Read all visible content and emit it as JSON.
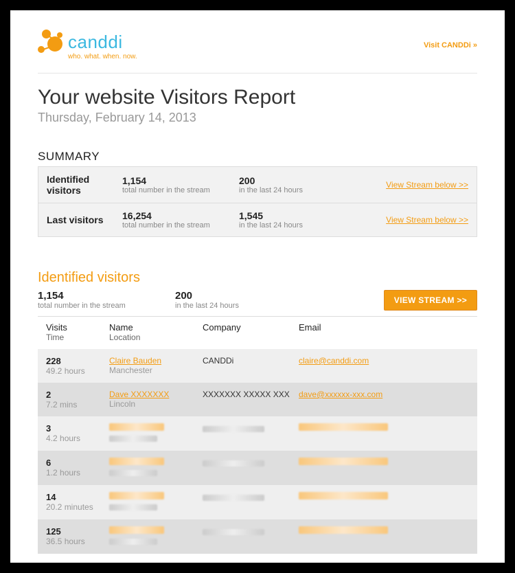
{
  "header": {
    "logo_text": "canddi",
    "logo_tagline": "who. what. when. now.",
    "visit_link": "Visit CANDDi »"
  },
  "title": {
    "heading": "Your website Visitors Report",
    "date": "Thursday, February 14, 2013"
  },
  "summary": {
    "heading": "SUMMARY",
    "rows": [
      {
        "label": "Identified visitors",
        "total_num": "1,154",
        "total_sub": "total number in the stream",
        "recent_num": "200",
        "recent_sub": "in the last 24 hours",
        "link": "View Stream below >>"
      },
      {
        "label": "Last visitors",
        "total_num": "16,254",
        "total_sub": "total number in the stream",
        "recent_num": "1,545",
        "recent_sub": "in the last 24 hours",
        "link": "View Stream below >>"
      }
    ]
  },
  "identified": {
    "title": "Identified visitors",
    "total_num": "1,154",
    "total_sub": "total number in the stream",
    "recent_num": "200",
    "recent_sub": "in the last 24 hours",
    "button": "VIEW STREAM >>",
    "cols": {
      "visits": "Visits",
      "time": "Time",
      "name": "Name",
      "location": "Location",
      "company": "Company",
      "email": "Email"
    },
    "rows": [
      {
        "visits": "228",
        "time": "49.2 hours",
        "name": "Claire Bauden",
        "location": "Manchester",
        "company": "CANDDi",
        "email": "claire@canddi.com",
        "blurred": false
      },
      {
        "visits": "2",
        "time": "7.2 mins",
        "name": "Dave XXXXXXX",
        "location": "Lincoln",
        "company": "XXXXXXX XXXXX XXX",
        "email": "dave@xxxxxx-xxx.com",
        "blurred": false
      },
      {
        "visits": "3",
        "time": "4.2 hours",
        "blurred": true
      },
      {
        "visits": "6",
        "time": "1.2 hours",
        "blurred": true
      },
      {
        "visits": "14",
        "time": "20.2 minutes",
        "blurred": true
      },
      {
        "visits": "125",
        "time": "36.5 hours",
        "blurred": true
      }
    ]
  }
}
